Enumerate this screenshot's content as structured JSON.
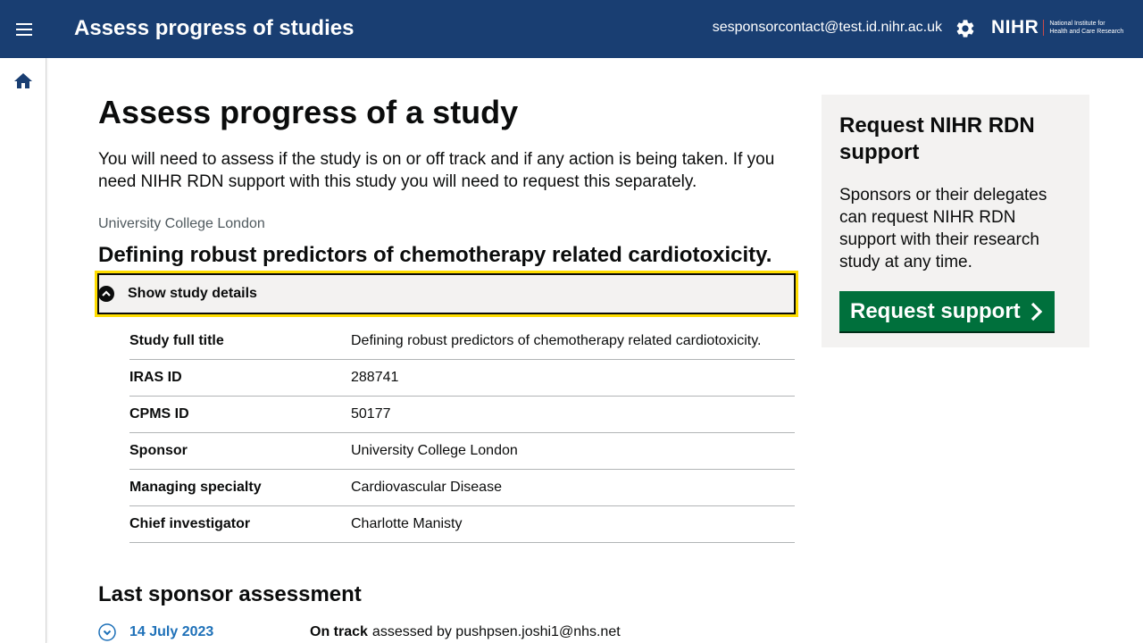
{
  "header": {
    "title": "Assess progress of studies",
    "user_email": "sesponsorcontact@test.id.nihr.ac.uk",
    "logo_main": "NIHR",
    "logo_sub_line1": "National Institute for",
    "logo_sub_line2": "Health and Care Research"
  },
  "page": {
    "title": "Assess progress of a study",
    "intro": "You will need to assess if the study is on or off track and if any action is being taken. If you need NIHR RDN support with this study you will need to request this separately.",
    "organisation": "University College London",
    "study_title": "Defining robust predictors of chemotherapy related cardiotoxicity.",
    "details_toggle_label": "Show study details"
  },
  "study_details": [
    {
      "key": "Study full title",
      "value": "Defining robust predictors of chemotherapy related cardiotoxicity."
    },
    {
      "key": "IRAS ID",
      "value": "288741"
    },
    {
      "key": "CPMS ID",
      "value": "50177"
    },
    {
      "key": "Sponsor",
      "value": "University College London"
    },
    {
      "key": "Managing specialty",
      "value": "Cardiovascular Disease"
    },
    {
      "key": "Chief investigator",
      "value": "Charlotte Manisty"
    }
  ],
  "last_assessment": {
    "heading": "Last sponsor assessment",
    "date": "14 July 2023",
    "status": "On track",
    "assessed_by": "assessed by pushpsen.joshi1@nhs.net"
  },
  "support": {
    "title": "Request NIHR RDN support",
    "text": "Sponsors or their delegates can request NIHR RDN support with their research study at any time.",
    "button_label": "Request support"
  },
  "colors": {
    "header_bg": "#193e72",
    "button_green": "#00703c",
    "focus_yellow": "#ffdd00",
    "link_blue": "#1d70b8",
    "panel_grey": "#f3f2f1"
  },
  "icons": {
    "menu": "menu-icon",
    "settings": "gear-icon",
    "home": "home-icon",
    "toggle_open": "chevron-up-circle-icon",
    "toggle_closed": "chevron-down-circle-icon",
    "button_arrow": "chevron-right-icon"
  }
}
